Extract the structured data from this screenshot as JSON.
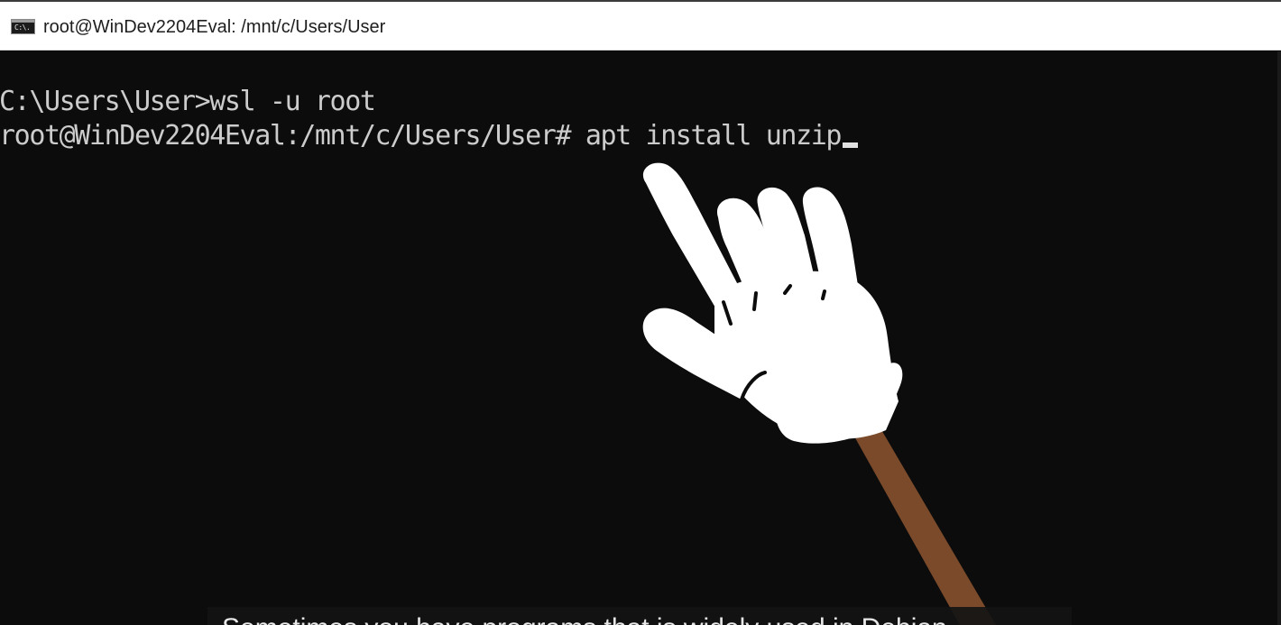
{
  "window": {
    "title": "root@WinDev2204Eval: /mnt/c/Users/User",
    "icon": "console-icon",
    "icon_glyph": "C:\\."
  },
  "console": {
    "lines": [
      {
        "text": "C:\\Users\\User>wsl -u root"
      },
      {
        "prompt": "root@WinDev2204Eval:/mnt/c/Users/User# ",
        "command": "apt install unzip"
      }
    ],
    "text_color": "#cccccc",
    "background_color": "#0c0c0c"
  },
  "overlay": {
    "pointer": "pointing-hand-icon",
    "glove_color": "#ffffff",
    "stick_color": "#7a4a2a"
  },
  "caption": {
    "text": "Sometimes you have programs that is widely used in Debian"
  }
}
